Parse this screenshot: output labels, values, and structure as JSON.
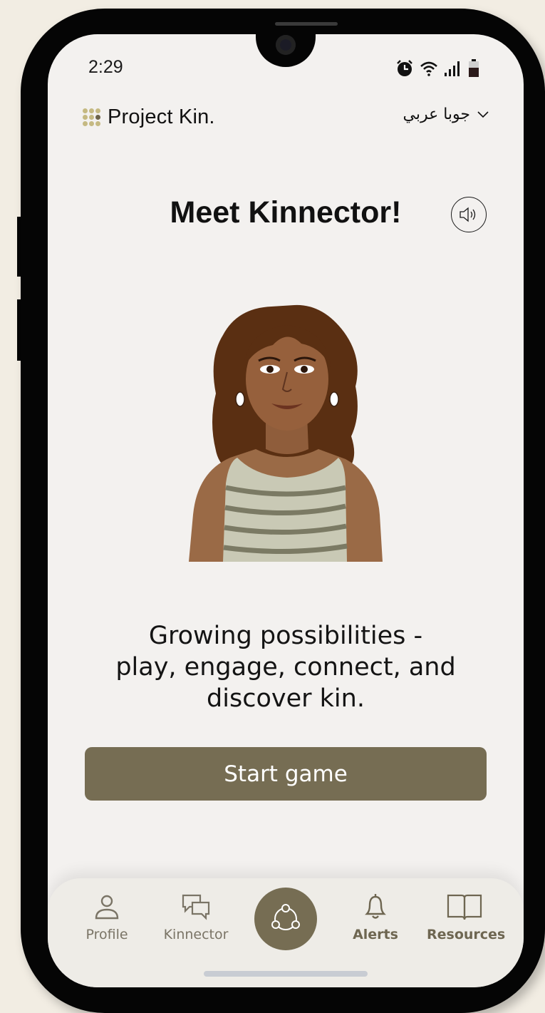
{
  "status_bar": {
    "time": "2:29"
  },
  "header": {
    "app_name": "Project Kin.",
    "language": "جوبا عربي"
  },
  "main": {
    "title": "Meet Kinnector!",
    "tagline_line1": "Growing possibilities -",
    "tagline_line2": "play, engage, connect, and",
    "tagline_line3": "discover kin.",
    "start_button": "Start game"
  },
  "nav": {
    "profile": "Profile",
    "kinnector": "Kinnector",
    "alerts": "Alerts",
    "resources": "Resources"
  },
  "icons": {
    "status": [
      "alarm-icon",
      "wifi-icon",
      "signal-icon",
      "battery-icon"
    ],
    "sound": "speaker-icon",
    "center": "network-icon"
  },
  "colors": {
    "accent": "#766d53",
    "screen_bg": "#f3f1ef",
    "logo_gold": "#c5b982"
  }
}
